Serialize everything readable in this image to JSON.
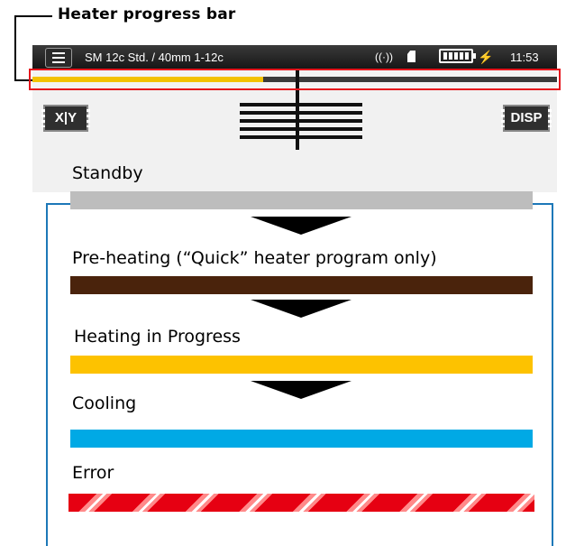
{
  "callout": {
    "title": "Heater progress bar"
  },
  "status_bar": {
    "menu_icon": "hamburger-menu-icon",
    "title": "SM 12c Std. / 40mm 1-12c",
    "wireless_symbol": "((·))",
    "battery_icon": "battery-full-icon",
    "charging_symbol": "⚡",
    "time": "11:53"
  },
  "heater_progress": {
    "fraction_complete": 0.44,
    "fill_color": "#f3c200",
    "remaining_color": "#3a3a3a"
  },
  "soft_buttons": {
    "xy_label": "X|Y",
    "disp_label": "DISP"
  },
  "legend": {
    "states": [
      {
        "label": "Standby",
        "color": "#bdbdbd"
      },
      {
        "label": "Pre-heating (“Quick” heater program only)",
        "color": "#4a230c"
      },
      {
        "label": "Heating in Progress",
        "color": "#fdc200"
      },
      {
        "label": "Cooling",
        "color": "#00a9e5"
      },
      {
        "label": "Error",
        "color": "#e60012",
        "pattern": "diagonal-stripes"
      }
    ]
  },
  "colors": {
    "highlight": "#e5151c",
    "panel_border": "#1d78b8"
  }
}
